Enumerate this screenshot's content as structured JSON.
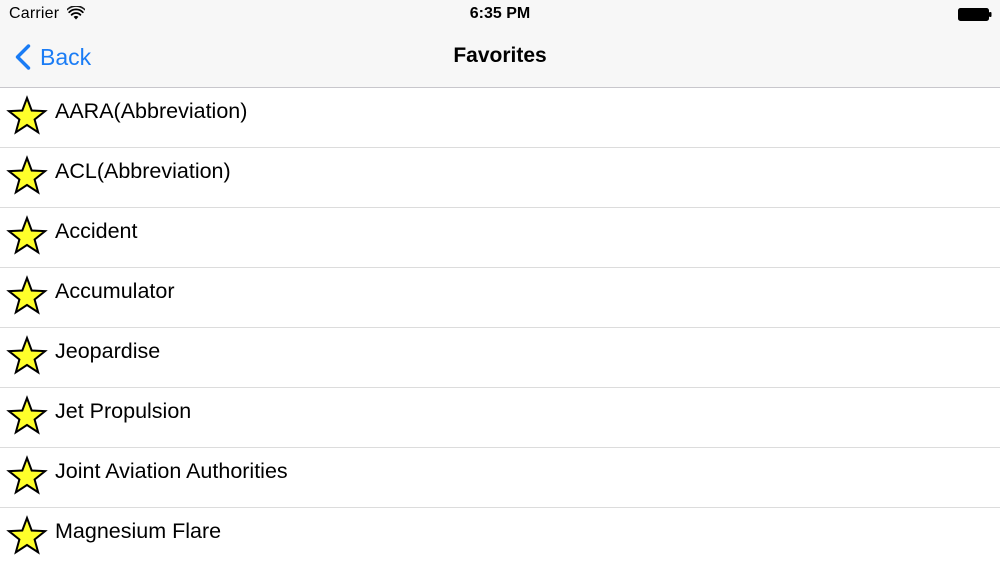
{
  "status_bar": {
    "carrier": "Carrier",
    "time": "6:35 PM",
    "wifi_icon": "wifi-icon",
    "battery_icon": "battery-icon"
  },
  "nav": {
    "back_label": "Back",
    "back_icon": "chevron-left-icon",
    "title": "Favorites"
  },
  "colors": {
    "accent": "#1a7cf5",
    "star_fill": "#ffff2a",
    "star_stroke": "#000000"
  },
  "favorites": [
    {
      "label": "AARA(Abbreviation)",
      "icon": "star-icon"
    },
    {
      "label": "ACL(Abbreviation)",
      "icon": "star-icon"
    },
    {
      "label": "Accident",
      "icon": "star-icon"
    },
    {
      "label": "Accumulator",
      "icon": "star-icon"
    },
    {
      "label": "Jeopardise",
      "icon": "star-icon"
    },
    {
      "label": "Jet Propulsion",
      "icon": "star-icon"
    },
    {
      "label": "Joint Aviation Authorities",
      "icon": "star-icon"
    },
    {
      "label": "Magnesium Flare",
      "icon": "star-icon"
    }
  ]
}
